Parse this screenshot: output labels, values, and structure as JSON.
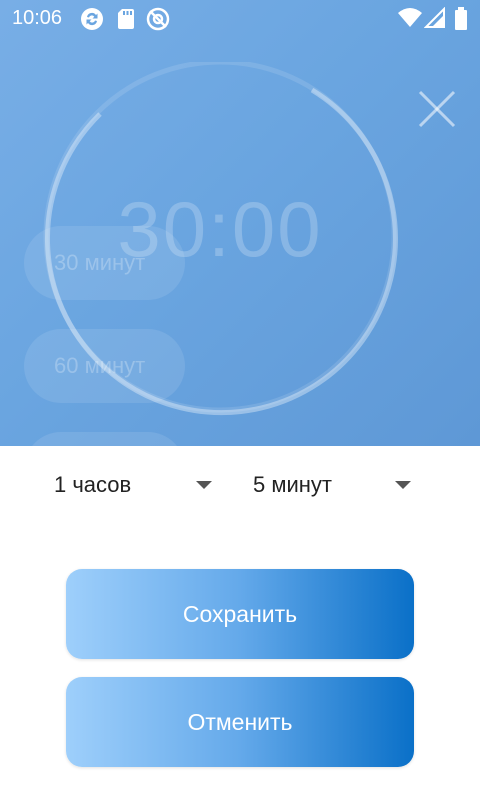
{
  "status_bar": {
    "time": "10:06",
    "icons": [
      "sync-icon",
      "sd-card-icon",
      "at-icon",
      "wifi-icon",
      "signal-icon",
      "battery-icon"
    ]
  },
  "timer": {
    "display": "30:00"
  },
  "presets": [
    {
      "label": "30 минут"
    },
    {
      "label": "60 минут"
    },
    {
      "label": ""
    }
  ],
  "pickers": {
    "hours": {
      "value": "1 часов"
    },
    "minutes": {
      "value": "5 минут"
    }
  },
  "buttons": {
    "save_label": "Сохранить",
    "cancel_label": "Отменить"
  },
  "colors": {
    "background": "#6aa5e0",
    "button_gradient_start": "#9ecffb",
    "button_gradient_end": "#0a70c8"
  }
}
